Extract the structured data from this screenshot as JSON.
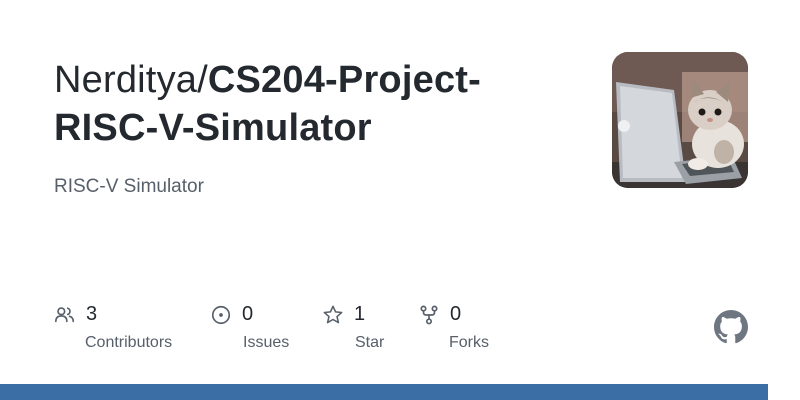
{
  "repo": {
    "owner": "Nerditya/",
    "name_line1": "CS204-Project-",
    "name_line2": "RISC-V-Simulator",
    "description": "RISC-V Simulator"
  },
  "stats": {
    "contributors": {
      "count": "3",
      "label": "Contributors",
      "icon": "people-icon"
    },
    "issues": {
      "count": "0",
      "label": "Issues",
      "icon": "issue-icon"
    },
    "stars": {
      "count": "1",
      "label": "Star",
      "icon": "star-icon"
    },
    "forks": {
      "count": "0",
      "label": "Forks",
      "icon": "fork-icon"
    }
  },
  "colors": {
    "accent_bar": "#3a6ea5",
    "text_primary": "#24292f",
    "text_secondary": "#57606a"
  },
  "avatar_description_icon": "cat-at-laptop-avatar"
}
